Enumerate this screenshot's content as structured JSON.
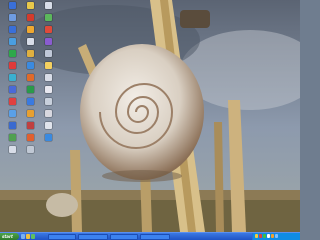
{
  "desktop": {
    "icons": [
      {
        "label": "",
        "color": "#3a6fd8"
      },
      {
        "label": "",
        "color": "#e8c84a"
      },
      {
        "label": "",
        "color": "#d8dde8"
      },
      {
        "label": "",
        "color": "#6e9be0"
      },
      {
        "label": "",
        "color": "#d33b2c"
      },
      {
        "label": "",
        "color": "#5cb85c"
      },
      {
        "label": "",
        "color": "#3a6fd8"
      },
      {
        "label": "",
        "color": "#f0a830"
      },
      {
        "label": "",
        "color": "#e04a3a"
      },
      {
        "label": "",
        "color": "#4a9ee0"
      },
      {
        "label": "",
        "color": "#d8dde8"
      },
      {
        "label": "",
        "color": "#8a5cd0"
      },
      {
        "label": "",
        "color": "#2ea84a"
      },
      {
        "label": "",
        "color": "#e0b040"
      },
      {
        "label": "",
        "color": "#c0c8d8"
      },
      {
        "label": "",
        "color": "#e03a3a"
      },
      {
        "label": "",
        "color": "#3a8ae0"
      },
      {
        "label": "",
        "color": "#f4d060"
      },
      {
        "label": "",
        "color": "#3ab0d0"
      },
      {
        "label": "",
        "color": "#e06a2a"
      },
      {
        "label": "",
        "color": "#d8dde8"
      },
      {
        "label": "",
        "color": "#4a6ad8"
      },
      {
        "label": "",
        "color": "#2a9a4a"
      },
      {
        "label": "",
        "color": "#e8e8f0"
      },
      {
        "label": "",
        "color": "#e04040"
      },
      {
        "label": "",
        "color": "#3a7ae0"
      },
      {
        "label": "",
        "color": "#c8d0dc"
      },
      {
        "label": "",
        "color": "#5aa0e8"
      },
      {
        "label": "",
        "color": "#e8a030"
      },
      {
        "label": "",
        "color": "#d8d8e0"
      },
      {
        "label": "",
        "color": "#3a6ad0"
      },
      {
        "label": "",
        "color": "#c04040"
      },
      {
        "label": "",
        "color": "#e0e4ec"
      },
      {
        "label": "",
        "color": "#50a050"
      },
      {
        "label": "",
        "color": "#e06030"
      },
      {
        "label": "",
        "color": "#3a8ae0"
      },
      {
        "label": "",
        "color": "#d8dde8"
      },
      {
        "label": "",
        "color": "#c0c8d4"
      }
    ]
  },
  "taskbar": {
    "start_label": "start",
    "quick_launch": [
      "#7ab0f0",
      "#f0c040",
      "#60c060"
    ],
    "tasks": [
      {
        "label": ""
      },
      {
        "label": ""
      },
      {
        "label": ""
      },
      {
        "label": ""
      }
    ],
    "tray_icons": [
      "#f0d040",
      "#e04040",
      "#40c040",
      "#ffffff",
      "#f0a030",
      "#80c0ff"
    ],
    "clock": ""
  }
}
